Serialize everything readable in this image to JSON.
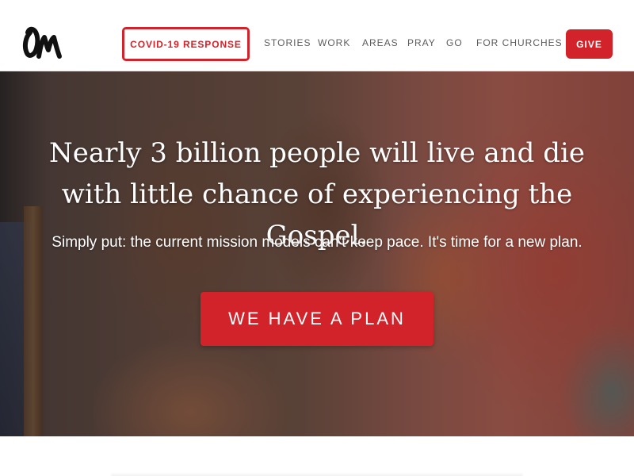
{
  "header": {
    "logo_text": "OM",
    "covid_label": "COVID-19 RESPONSE",
    "nav": [
      {
        "label": "STORIES"
      },
      {
        "label": "WORK"
      },
      {
        "label": "AREAS"
      },
      {
        "label": "PRAY"
      },
      {
        "label": "GO"
      },
      {
        "label": "FOR CHURCHES"
      }
    ],
    "give_label": "GIVE"
  },
  "hero": {
    "headline": "Nearly 3 billion people will live and die with little chance of experiencing the Gospel.",
    "subheadline": "Simply put: the current mission models can't keep pace. It's time for a new plan.",
    "cta_label": "WE HAVE A PLAN"
  },
  "colors": {
    "accent": "#d2232a",
    "nav_text": "#5c5c5c"
  }
}
